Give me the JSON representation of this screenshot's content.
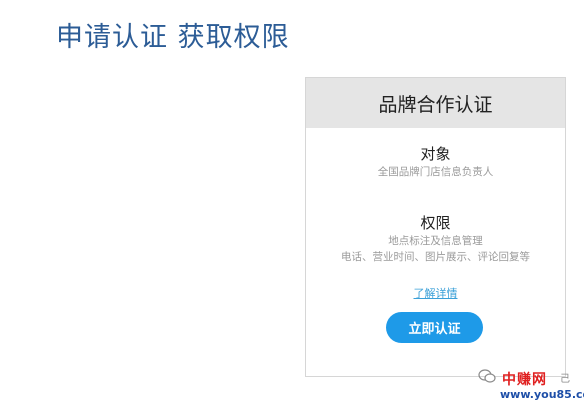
{
  "page": {
    "title": "申请认证 获取权限"
  },
  "card": {
    "title": "品牌合作认证",
    "sections": [
      {
        "title": "对象",
        "lines": [
          "全国品牌门店信息负责人"
        ]
      },
      {
        "title": "权限",
        "lines": [
          "地点标注及信息管理",
          "电话、营业时间、图片展示、评论回复等"
        ]
      }
    ],
    "details_link": "了解详情",
    "cta_button": "立即认证"
  },
  "watermark": {
    "icon": "wechat-icon",
    "name": "中赚网",
    "trail": "己",
    "url": "www.you85.com"
  },
  "colors": {
    "title": "#2c5c96",
    "header_bg": "#e5e5e5",
    "button": "#1e9ae8",
    "link": "#3aa0d8",
    "watermark_red": "#e02020",
    "watermark_blue": "#1e4fa8"
  }
}
